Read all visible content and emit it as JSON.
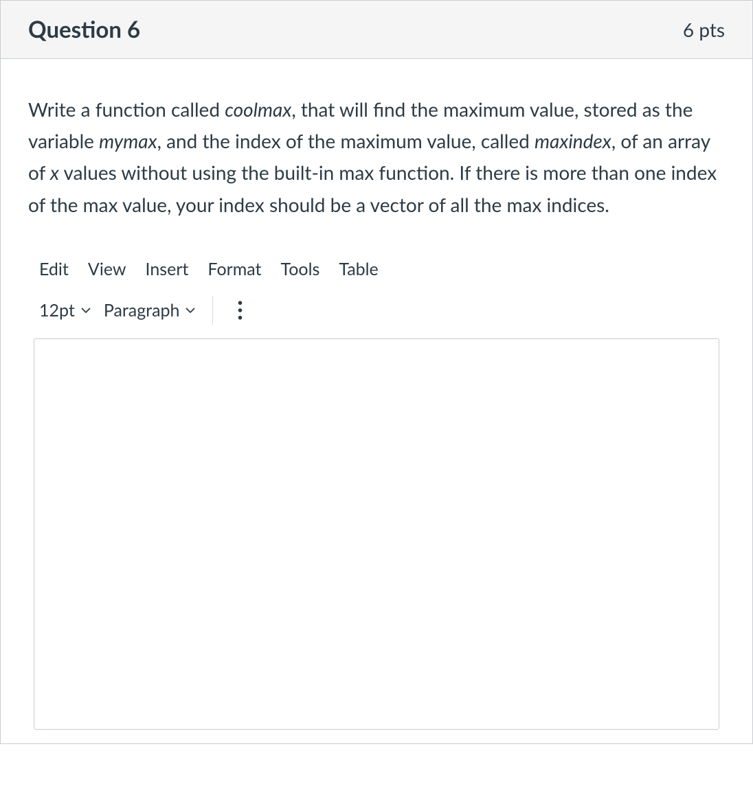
{
  "header": {
    "title": "Question 6",
    "points": "6 pts"
  },
  "prompt": {
    "t1": "Write a function called ",
    "i1": "coolmax",
    "t2": ", that will find the maximum value, stored as the variable ",
    "i2": "mymax",
    "t3": ", and the index of the maximum value, called ",
    "i3": "maxindex",
    "t4": ", of an array of ",
    "i4": "x",
    "t5": " values without using the built-in max function. If there is more than one index of the max value, your index should be a vector of all the max indices."
  },
  "editor": {
    "menu": {
      "edit": "Edit",
      "view": "View",
      "insert": "Insert",
      "format": "Format",
      "tools": "Tools",
      "table": "Table"
    },
    "toolbar": {
      "fontsize": "12pt",
      "style": "Paragraph"
    }
  }
}
